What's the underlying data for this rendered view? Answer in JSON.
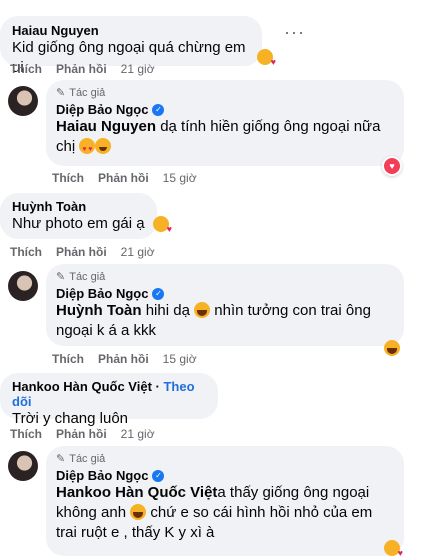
{
  "comments": [
    {
      "name": "Haiau Nguyen",
      "text": "Kid giống ông ngoại quá chừng em ui",
      "actions": {
        "like": "Thích",
        "reply": "Phản hồi",
        "time": "21 giờ"
      },
      "emoji": "kiss-emoji"
    },
    {
      "author_badge": "Tác giả",
      "name": "Diệp Bảo Ngọc",
      "mention": "Haiau Nguyen",
      "text": "dạ tính hiền giống ông ngoại nữa chị",
      "actions": {
        "like": "Thích",
        "reply": "Phản hồi",
        "time": "15 giờ"
      }
    },
    {
      "name": "Huỳnh Toàn",
      "text": "Như photo em gái ạ",
      "actions": {
        "like": "Thích",
        "reply": "Phản hồi",
        "time": "21 giờ"
      }
    },
    {
      "author_badge": "Tác giả",
      "name": "Diệp Bảo Ngọc",
      "mention": "Huỳnh Toàn",
      "text_a": "hihi dạ",
      "text_b": "nhìn tưởng con trai ông ngoại k á a kkk",
      "actions": {
        "like": "Thích",
        "reply": "Phản hồi",
        "time": "15 giờ"
      }
    },
    {
      "name": "Hankoo Hàn Quốc Việt",
      "follow": "Theo dõi",
      "text": "Trời y chang luôn",
      "actions": {
        "like": "Thích",
        "reply": "Phản hồi",
        "time": "21 giờ"
      }
    },
    {
      "author_badge": "Tác giả",
      "name": "Diệp Bảo Ngọc",
      "mention": "Hankoo Hàn Quốc Việt",
      "text_a": "a thấy giống ông ngoại không anh",
      "text_b": "chứ e so cái hình hồi nhỏ của em trai ruột e , thấy K y xì à"
    }
  ],
  "more_label": "···"
}
